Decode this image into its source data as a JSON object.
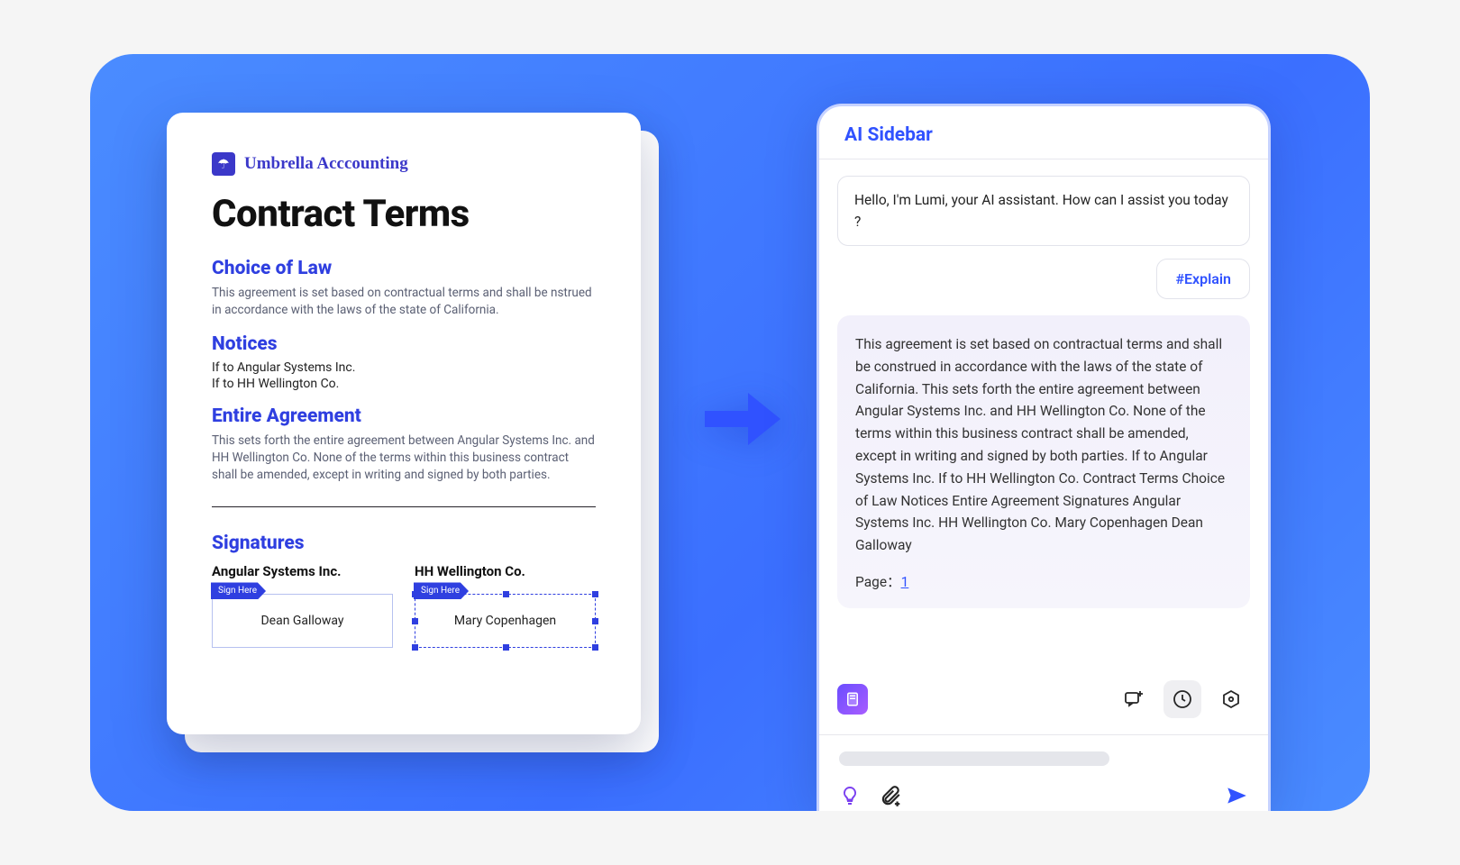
{
  "document": {
    "brand": "Umbrella Acccounting",
    "title": "Contract Terms",
    "sections": {
      "choice_of_law": {
        "heading": "Choice of Law",
        "body": "This agreement is set based on contractual terms and shall be nstrued in accordance with the laws of the state of California."
      },
      "notices": {
        "heading": "Notices",
        "lines": [
          "If to Angular Systems Inc.",
          "If to HH Wellington Co."
        ]
      },
      "entire_agreement": {
        "heading": "Entire Agreement",
        "body": "This sets forth the entire agreement between Angular Systems Inc. and HH Wellington Co. None of the terms within this business contract shall be amended, except in writing and signed by both parties."
      },
      "signatures": {
        "heading": "Signatures",
        "parties": [
          {
            "company": "Angular Systems Inc.",
            "signer": "Dean Galloway",
            "tag": "Sign Here",
            "selected": false
          },
          {
            "company": "HH Wellington Co.",
            "signer": "Mary Copenhagen",
            "tag": "Sign Here",
            "selected": true
          }
        ]
      }
    }
  },
  "sidebar": {
    "title": "AI Sidebar",
    "greeting": "Hello, I'm Lumi, your AI assistant. How can I assist you today ?",
    "chip": "#Explain",
    "answer": "This agreement is set based on contractual terms and shall be construed in accordance with the laws of the state of California. This sets forth the entire agreement between Angular Systems Inc. and HH Wellington Co. None of the terms within this business contract shall be amended, except in writing and signed by both parties. If to Angular Systems Inc. If to HH Wellington Co. Contract Terms Choice of Law Notices Entire Agreement Signatures Angular Systems Inc. HH Wellington Co. Mary Copenhagen Dean Galloway",
    "page_label": "Page：",
    "page_number": "1",
    "input_placeholder": ""
  }
}
